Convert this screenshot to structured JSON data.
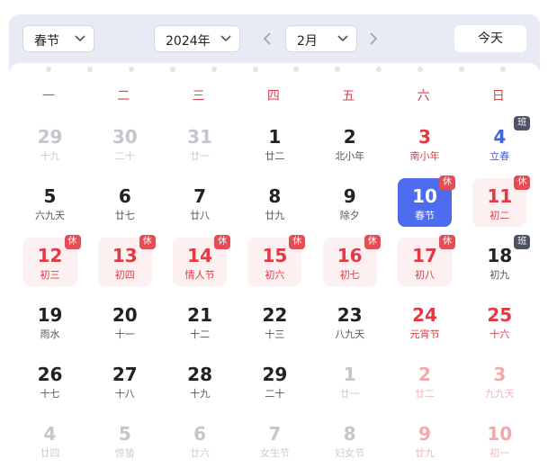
{
  "toolbar": {
    "holiday_select": "春节",
    "year_select": "2024年",
    "month_select": "2月",
    "prev_month": "‹",
    "next_month": "›",
    "today_label": "今天"
  },
  "weekdays": [
    "一",
    "二",
    "三",
    "四",
    "五",
    "六",
    "日"
  ],
  "badges": {
    "rest": "休",
    "work": "班"
  },
  "colors": {
    "accent": "#4d6cf0",
    "holiday_red": "#e23a44",
    "rest_badge": "#e54d56",
    "work_badge": "#4e5366"
  },
  "rows": [
    [
      {
        "day": "29",
        "lunar": "十九",
        "state": "grey"
      },
      {
        "day": "30",
        "lunar": "二十",
        "state": "grey"
      },
      {
        "day": "31",
        "lunar": "廿一",
        "state": "grey"
      },
      {
        "day": "1",
        "lunar": "廿二",
        "state": "normal"
      },
      {
        "day": "2",
        "lunar": "北小年",
        "state": "normal"
      },
      {
        "day": "3",
        "lunar": "南小年",
        "state": "red"
      },
      {
        "day": "4",
        "lunar": "立春",
        "state": "blue",
        "badge": "work"
      }
    ],
    [
      {
        "day": "5",
        "lunar": "六九天",
        "state": "normal"
      },
      {
        "day": "6",
        "lunar": "廿七",
        "state": "normal"
      },
      {
        "day": "7",
        "lunar": "廿八",
        "state": "normal"
      },
      {
        "day": "8",
        "lunar": "廿九",
        "state": "normal"
      },
      {
        "day": "9",
        "lunar": "除夕",
        "state": "normal"
      },
      {
        "day": "10",
        "lunar": "春节",
        "state": "selected",
        "badge": "rest"
      },
      {
        "day": "11",
        "lunar": "初二",
        "state": "red",
        "badge": "rest",
        "holiday": true
      }
    ],
    [
      {
        "day": "12",
        "lunar": "初三",
        "state": "red",
        "badge": "rest",
        "holiday": true
      },
      {
        "day": "13",
        "lunar": "初四",
        "state": "red",
        "badge": "rest",
        "holiday": true
      },
      {
        "day": "14",
        "lunar": "情人节",
        "state": "red",
        "badge": "rest",
        "holiday": true
      },
      {
        "day": "15",
        "lunar": "初六",
        "state": "red",
        "badge": "rest",
        "holiday": true
      },
      {
        "day": "16",
        "lunar": "初七",
        "state": "red",
        "badge": "rest",
        "holiday": true
      },
      {
        "day": "17",
        "lunar": "初八",
        "state": "red",
        "badge": "rest",
        "holiday": true
      },
      {
        "day": "18",
        "lunar": "初九",
        "state": "normal",
        "badge": "work"
      }
    ],
    [
      {
        "day": "19",
        "lunar": "雨水",
        "state": "normal"
      },
      {
        "day": "20",
        "lunar": "十一",
        "state": "normal"
      },
      {
        "day": "21",
        "lunar": "十二",
        "state": "normal"
      },
      {
        "day": "22",
        "lunar": "十三",
        "state": "normal"
      },
      {
        "day": "23",
        "lunar": "八九天",
        "state": "normal"
      },
      {
        "day": "24",
        "lunar": "元宵节",
        "state": "red"
      },
      {
        "day": "25",
        "lunar": "十六",
        "state": "red"
      }
    ],
    [
      {
        "day": "26",
        "lunar": "十七",
        "state": "normal"
      },
      {
        "day": "27",
        "lunar": "十八",
        "state": "normal"
      },
      {
        "day": "28",
        "lunar": "十九",
        "state": "normal"
      },
      {
        "day": "29",
        "lunar": "二十",
        "state": "normal"
      },
      {
        "day": "1",
        "lunar": "廿一",
        "state": "grey"
      },
      {
        "day": "2",
        "lunar": "廿二",
        "state": "pink"
      },
      {
        "day": "3",
        "lunar": "九九天",
        "state": "pink"
      }
    ],
    [
      {
        "day": "4",
        "lunar": "廿四",
        "state": "grey"
      },
      {
        "day": "5",
        "lunar": "惊蛰",
        "state": "grey"
      },
      {
        "day": "6",
        "lunar": "廿六",
        "state": "grey"
      },
      {
        "day": "7",
        "lunar": "女生节",
        "state": "grey"
      },
      {
        "day": "8",
        "lunar": "妇女节",
        "state": "grey"
      },
      {
        "day": "9",
        "lunar": "廿九",
        "state": "pink"
      },
      {
        "day": "10",
        "lunar": "初一",
        "state": "pink"
      }
    ]
  ]
}
